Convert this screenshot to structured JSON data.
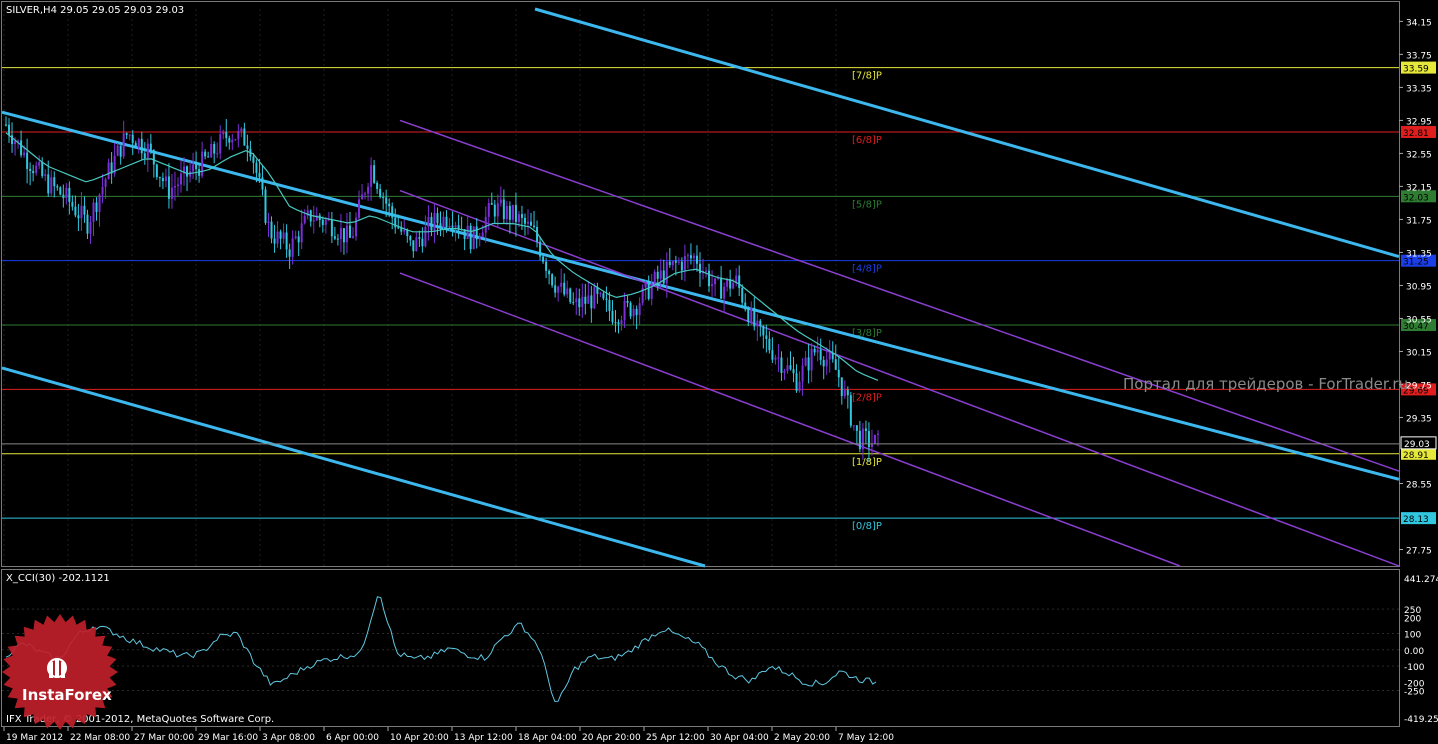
{
  "header": {
    "symbol_line": "SILVER,H4  29.05 29.05 29.03 29.03"
  },
  "watermark": "Портал для трейдеров - ForTrader.ru",
  "subwindow": {
    "title": "X_CCI(30) -202.1121"
  },
  "copyright": "IFX Trader, © 2001-2012, MetaQuotes Software Corp.",
  "logo": {
    "text": "InstaForex"
  },
  "colors": {
    "background": "#000000",
    "grid": "#6a6a6a",
    "bull": "#7b2fd6",
    "bear": "#31c7df",
    "ma": "#48c9c0",
    "channel_main": "#3cb8ee",
    "channel_sub": "#8a3fd0",
    "cci": "#5fc7e0",
    "logo": "#c0202a"
  },
  "price_axis": {
    "min": 27.55,
    "max": 34.3,
    "ticks": [
      "34.15",
      "33.75",
      "33.35",
      "32.95",
      "32.55",
      "32.15",
      "31.75",
      "31.35",
      "30.95",
      "30.55",
      "30.15",
      "29.75",
      "29.35",
      "28.55",
      "27.75"
    ],
    "current": "29.03"
  },
  "murray_levels": [
    {
      "label": "[7/8]P",
      "value": "33.59",
      "color": "#e5e83a"
    },
    {
      "label": "[6/8]P",
      "value": "32.81",
      "color": "#e01e1e"
    },
    {
      "label": "[5/8]P",
      "value": "32.03",
      "color": "#2e7d32"
    },
    {
      "label": "[4/8]P",
      "value": "31.25",
      "color": "#1a3fe6"
    },
    {
      "label": "[3/8]P",
      "value": "30.47",
      "color": "#2e7d32"
    },
    {
      "label": "[2/8]P",
      "value": "29.69",
      "color": "#e01e1e"
    },
    {
      "label": "[1/8]P",
      "value": "28.91",
      "color": "#e5e83a"
    },
    {
      "label": "[0/8]P",
      "value": "28.13",
      "color": "#31c7df"
    }
  ],
  "time_axis": [
    "19 Mar 2012",
    "22 Mar 08:00",
    "27 Mar 00:00",
    "29 Mar 16:00",
    "3 Apr 08:00",
    "6 Apr 00:00",
    "10 Apr 20:00",
    "13 Apr 12:00",
    "18 Apr 04:00",
    "20 Apr 20:00",
    "25 Apr 12:00",
    "30 Apr 04:00",
    "2 May 20:00",
    "7 May 12:00"
  ],
  "cci_axis": {
    "min": -419.2546,
    "max": 441.274,
    "ticks": [
      "441.274",
      "250",
      "200",
      "100",
      "0.00",
      "-100",
      "-200",
      "-250",
      "-419.2546"
    ]
  },
  "chart_data": [
    {
      "type": "candlestick",
      "title": "SILVER,H4",
      "ylim": [
        27.55,
        34.3
      ],
      "x": [
        "19 Mar 2012",
        "22 Mar 08:00",
        "27 Mar 00:00",
        "29 Mar 16:00",
        "3 Apr 08:00",
        "6 Apr 00:00",
        "10 Apr 20:00",
        "13 Apr 12:00",
        "18 Apr 04:00",
        "20 Apr 20:00",
        "25 Apr 12:00",
        "30 Apr 04:00",
        "2 May 20:00",
        "7 May 12:00"
      ],
      "close_path": [
        32.9,
        32.5,
        32.2,
        32.0,
        31.7,
        32.3,
        32.8,
        32.6,
        32.1,
        32.3,
        32.5,
        32.8,
        32.7,
        31.6,
        31.4,
        31.8,
        31.7,
        31.5,
        32.4,
        31.8,
        31.4,
        31.7,
        31.8,
        31.5,
        31.9,
        31.8,
        31.6,
        31.0,
        30.7,
        30.8,
        30.6,
        30.7,
        31.0,
        31.2,
        31.3,
        30.9,
        31.0,
        30.4,
        30.1,
        29.8,
        30.2,
        29.9,
        29.1,
        29.03
      ],
      "ma_path": [
        32.8,
        32.6,
        32.4,
        32.3,
        32.2,
        32.3,
        32.4,
        32.5,
        32.4,
        32.3,
        32.35,
        32.5,
        32.6,
        32.3,
        31.9,
        31.8,
        31.75,
        31.7,
        31.8,
        31.7,
        31.6,
        31.6,
        31.65,
        31.6,
        31.7,
        31.7,
        31.65,
        31.3,
        31.1,
        30.95,
        30.8,
        30.85,
        30.95,
        31.1,
        31.15,
        31.05,
        31.0,
        30.8,
        30.6,
        30.4,
        30.25,
        30.1,
        29.9,
        29.8
      ]
    },
    {
      "type": "line",
      "title": "X_CCI(30) -202.1121",
      "ylim": [
        -419.2546,
        441.274
      ],
      "values": [
        -30,
        40,
        -20,
        -60,
        90,
        150,
        110,
        60,
        20,
        -10,
        -40,
        -20,
        80,
        100,
        -80,
        -220,
        -160,
        -100,
        -60,
        -40,
        -20,
        370,
        -20,
        -60,
        -40,
        10,
        -30,
        -50,
        80,
        160,
        20,
        -350,
        -120,
        -40,
        -60,
        -20,
        60,
        130,
        80,
        30,
        -80,
        -160,
        -190,
        -100,
        -140,
        -200,
        -210,
        -130,
        -180,
        -200
      ]
    }
  ]
}
